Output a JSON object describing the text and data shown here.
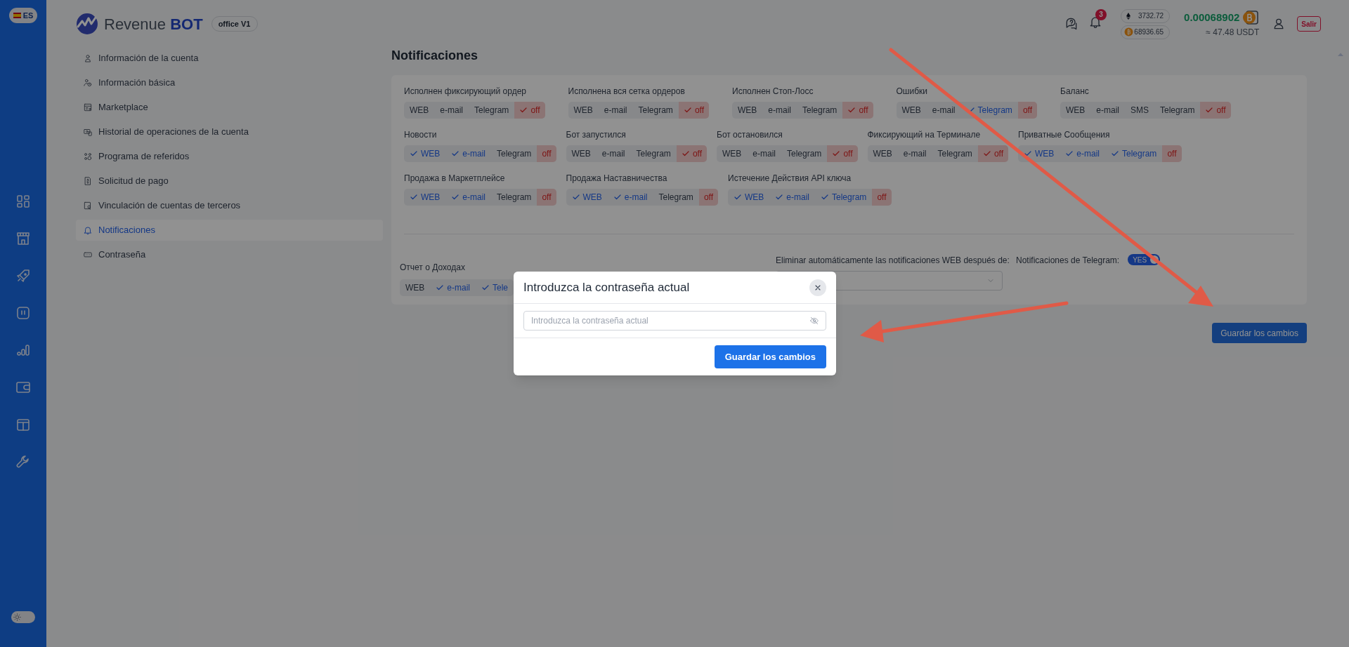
{
  "rail": {
    "language": "ES",
    "theme_toggle": {
      "on": false
    }
  },
  "logo": {
    "text": "Revenue **BOT**",
    "version": "office V1"
  },
  "header": {
    "notifications_count": "3",
    "prices": [
      {
        "kind": "eth",
        "value": "3732.72"
      },
      {
        "kind": "btc",
        "value": "68936.65"
      }
    ],
    "balance": "0.00068902",
    "balance_usdt": "≈ 47.48 USDT",
    "logout": "Salir"
  },
  "menu": [
    {
      "label": "Información de la cuenta",
      "selected": false
    },
    {
      "label": "Información básica",
      "selected": false
    },
    {
      "label": "Marketplace",
      "selected": false
    },
    {
      "label": "Historial de operaciones de la cuenta",
      "selected": false
    },
    {
      "label": "Programa de referidos",
      "selected": false
    },
    {
      "label": "Solicitud de pago",
      "selected": false
    },
    {
      "label": "Vinculación de cuentas de terceros",
      "selected": false
    },
    {
      "label": "Notificaciones",
      "selected": true
    },
    {
      "label": "Contraseña",
      "selected": false
    }
  ],
  "page_title": "Notificaciones",
  "notification_rows": [
    {
      "groups": [
        {
          "title": "Исполнен фиксирующий ордер",
          "options": [
            {
              "label": "WEB",
              "checked": false
            },
            {
              "label": "e-mail",
              "checked": false
            },
            {
              "label": "Telegram",
              "checked": false
            },
            {
              "label": "off",
              "kind": "off",
              "checked": true
            }
          ]
        },
        {
          "title": "Исполнена вся сетка ордеров",
          "options": [
            {
              "label": "WEB",
              "checked": false
            },
            {
              "label": "e-mail",
              "checked": false
            },
            {
              "label": "Telegram",
              "checked": false
            },
            {
              "label": "off",
              "kind": "off",
              "checked": true
            }
          ]
        },
        {
          "title": "Исполнен Стоп-Лосс",
          "options": [
            {
              "label": "WEB",
              "checked": false
            },
            {
              "label": "e-mail",
              "checked": false
            },
            {
              "label": "Telegram",
              "checked": false
            },
            {
              "label": "off",
              "kind": "off",
              "checked": true
            }
          ]
        },
        {
          "title": "Ошибки",
          "options": [
            {
              "label": "WEB",
              "checked": false
            },
            {
              "label": "e-mail",
              "checked": false
            },
            {
              "label": "Telegram",
              "checked": true
            },
            {
              "label": "off",
              "kind": "off",
              "checked": false
            }
          ]
        },
        {
          "title": "Баланс",
          "options": [
            {
              "label": "WEB",
              "checked": false
            },
            {
              "label": "e-mail",
              "checked": false
            },
            {
              "label": "SMS",
              "checked": false
            },
            {
              "label": "Telegram",
              "checked": false
            },
            {
              "label": "off",
              "kind": "off",
              "checked": true
            }
          ]
        }
      ]
    },
    {
      "groups": [
        {
          "title": "Новости",
          "options": [
            {
              "label": "WEB",
              "checked": true
            },
            {
              "label": "e-mail",
              "checked": true
            },
            {
              "label": "Telegram",
              "checked": false
            },
            {
              "label": "off",
              "kind": "off",
              "checked": false
            }
          ]
        },
        {
          "title": "Бот запустился",
          "options": [
            {
              "label": "WEB",
              "checked": false
            },
            {
              "label": "e-mail",
              "checked": false
            },
            {
              "label": "Telegram",
              "checked": false
            },
            {
              "label": "off",
              "kind": "off",
              "checked": true
            }
          ]
        },
        {
          "title": "Бот остановился",
          "options": [
            {
              "label": "WEB",
              "checked": false
            },
            {
              "label": "e-mail",
              "checked": false
            },
            {
              "label": "Telegram",
              "checked": false
            },
            {
              "label": "off",
              "kind": "off",
              "checked": true
            }
          ]
        },
        {
          "title": "Фиксирующий на Терминале",
          "options": [
            {
              "label": "WEB",
              "checked": false
            },
            {
              "label": "e-mail",
              "checked": false
            },
            {
              "label": "Telegram",
              "checked": false
            },
            {
              "label": "off",
              "kind": "off",
              "checked": true
            }
          ]
        },
        {
          "title": "Приватные Сообщения",
          "options": [
            {
              "label": "WEB",
              "checked": true
            },
            {
              "label": "e-mail",
              "checked": true
            },
            {
              "label": "Telegram",
              "checked": true
            },
            {
              "label": "off",
              "kind": "off",
              "checked": false
            }
          ]
        }
      ]
    },
    {
      "groups": [
        {
          "title": "Продажа в Маркетплейсе",
          "options": [
            {
              "label": "WEB",
              "checked": true
            },
            {
              "label": "e-mail",
              "checked": true
            },
            {
              "label": "Telegram",
              "checked": false
            },
            {
              "label": "off",
              "kind": "off",
              "checked": false
            }
          ]
        },
        {
          "title": "Продажа Наставничества",
          "options": [
            {
              "label": "WEB",
              "checked": true
            },
            {
              "label": "e-mail",
              "checked": true
            },
            {
              "label": "Telegram",
              "checked": false
            },
            {
              "label": "off",
              "kind": "off",
              "checked": false
            }
          ]
        },
        {
          "title": "Истечение Действия API ключа",
          "options": [
            {
              "label": "WEB",
              "checked": true
            },
            {
              "label": "e-mail",
              "checked": true
            },
            {
              "label": "Telegram",
              "checked": true
            },
            {
              "label": "off",
              "kind": "off",
              "checked": false
            }
          ]
        }
      ]
    }
  ],
  "income_report": {
    "title": "Отчет о Доходах",
    "options": [
      {
        "label": "WEB",
        "checked": false
      },
      {
        "label": "e-mail",
        "checked": true
      },
      {
        "label": "Tele",
        "checked": true
      }
    ]
  },
  "auto_delete": {
    "label": "Eliminar automáticamente las notificaciones WEB después de:"
  },
  "telegram_notifications": {
    "label": "Notificaciones de Telegram:",
    "toggle_text": "YES",
    "on": true
  },
  "save_button": "Guardar los cambios",
  "modal": {
    "title": "Introduzca la contraseña actual",
    "placeholder": "Introduzca la contraseña actual",
    "button": "Guardar los cambios"
  }
}
